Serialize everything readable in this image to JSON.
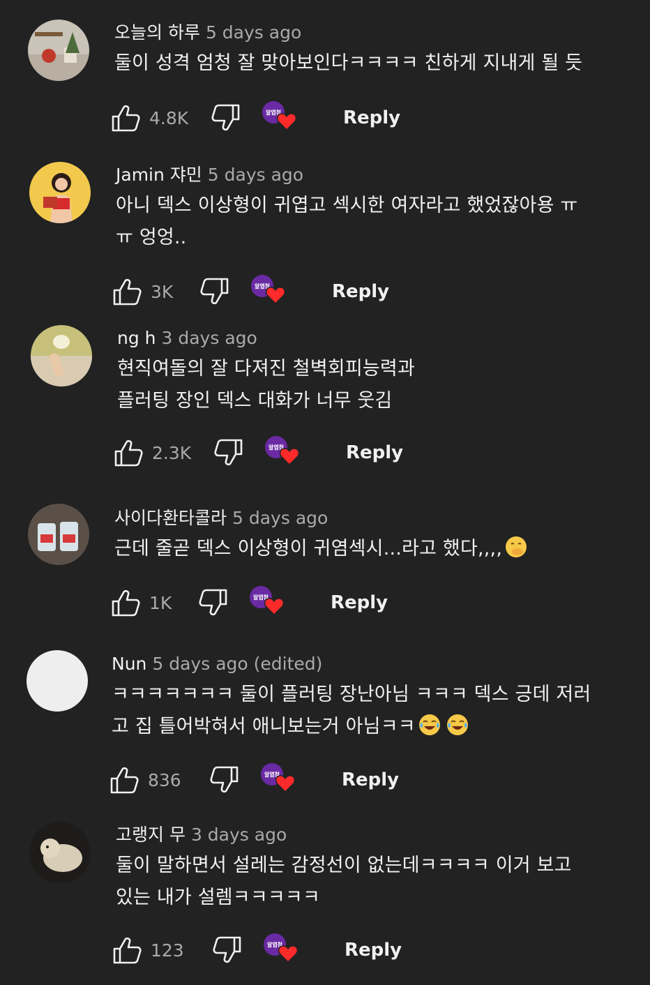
{
  "comments": [
    {
      "author": "오늘의 하루",
      "time": "5 days ago",
      "lines": [
        "둘이 성격 엄청 잘 맞아보인다ㅋㅋㅋㅋ 친하게 지내게 될 듯"
      ],
      "likes": "4.8K",
      "creator_badge": "알엽첨",
      "reply": "Reply"
    },
    {
      "author": "Jamin 쟈민",
      "time": "5 days ago",
      "lines": [
        "아니 덱스 이상형이 귀엽고 섹시한 여자라고 했었잖아용 ㅠ",
        "ㅠ 엉엉.."
      ],
      "likes": "3K",
      "creator_badge": "알엽첨",
      "reply": "Reply"
    },
    {
      "author": "ng h",
      "time": "3 days ago",
      "lines": [
        "현직여돌의 잘 다져진 철벽회피능력과",
        "플러팅 장인 덱스 대화가 너무 웃김"
      ],
      "likes": "2.3K",
      "creator_badge": "알엽첨",
      "reply": "Reply"
    },
    {
      "author": "사이다환타콜라",
      "time": "5 days ago",
      "lines": [
        "근데 줄곧 덱스 이상형이 귀염섹시...라고 했다,,,,"
      ],
      "likes": "1K",
      "creator_badge": "알엽첨",
      "reply": "Reply"
    },
    {
      "author": "Nun",
      "time": "5 days ago (edited)",
      "lines": [
        "ㅋㅋㅋㅋㅋㅋㅋ 둘이 플러팅 장난아님 ㅋㅋㅋ 덱스 긍데 저러",
        "고 집 틀어박혀서 애니보는거 아님ㅋㅋ"
      ],
      "likes": "836",
      "creator_badge": "알엽첨",
      "reply": "Reply"
    },
    {
      "author": "고랭지 무",
      "time": "3 days ago",
      "lines": [
        "둘이 말하면서 설레는 감정선이 없는데ㅋㅋㅋㅋ 이거 보고",
        "있는 내가 설렘ㅋㅋㅋㅋㅋ"
      ],
      "likes": "123",
      "creator_badge": "알엽첨",
      "reply": "Reply"
    }
  ],
  "colors": {
    "background": "#222222",
    "text": "#f1f1f1",
    "secondary": "#aaaaaa",
    "badge": "#6a2aa3",
    "heart": "#ff2a2a"
  }
}
